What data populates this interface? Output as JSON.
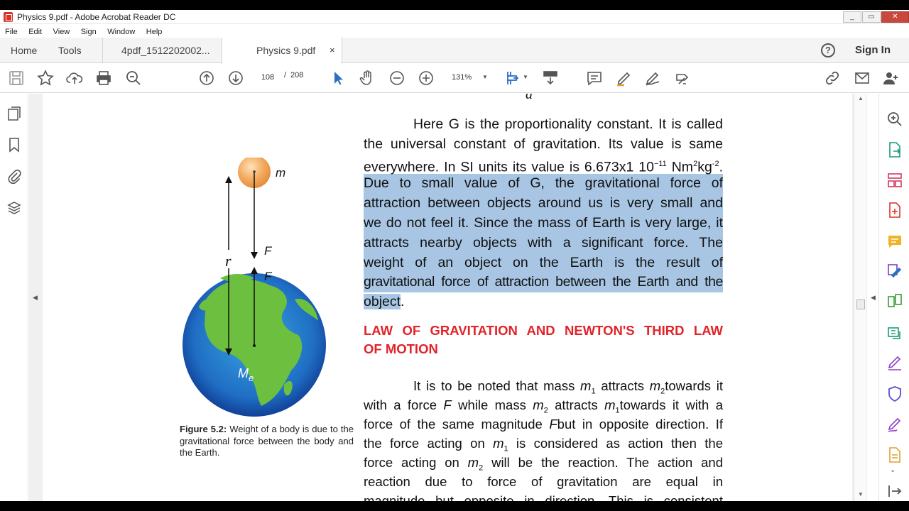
{
  "window": {
    "title": "Physics 9.pdf - Adobe Acrobat Reader DC",
    "controls": [
      "_",
      "▭",
      "✕"
    ]
  },
  "menu": [
    "File",
    "Edit",
    "View",
    "Sign",
    "Window",
    "Help"
  ],
  "tabs": {
    "home": "Home",
    "tools": "Tools",
    "doc1": "4pdf_1512202002...",
    "doc2": "Physics 9.pdf",
    "close": "×",
    "signin": "Sign In",
    "help": "?"
  },
  "toolbar": {
    "page_current": "108",
    "page_sep": "/",
    "page_total": "208",
    "zoom": "131%"
  },
  "document": {
    "top_fragment": "d",
    "para1_lines": [
      "Here G is the proportionality constant. It is called",
      "the universal constant of gravitation. Its value is same",
      "everywhere. In SI units its value is 6.673x1 10"
    ],
    "para1_unit_sup1": "−11",
    "para1_unit_mid": " Nm",
    "para1_unit_sup2": "2",
    "para1_unit_kg": "kg",
    "para1_unit_sup3": "-2",
    "para1_unit_end": ".",
    "highlighted_lines": [
      "Due to small value of G, the gravitational force of",
      "attraction between objects around us is very small and",
      "we do not feel it. Since the mass of Earth is very large, it",
      "attracts nearby objects with a significant force. The",
      "weight of an object on the Earth is the result of",
      "gravitational force of attraction between the Earth and the",
      "object"
    ],
    "highlight_end": ".",
    "section_heading_line1": "LAW OF GRAVITATION AND NEWTON'S THIRD LAW",
    "section_heading_line2": "OF MOTION",
    "para2": {
      "l1a": "It is to be noted that mass ",
      "m": "m",
      "s1": "1",
      "s2": "2",
      "l1b": " attracts ",
      "l1c": "towards it",
      "l2a": "with a force ",
      "F": "F",
      "l2b": " while mass ",
      "l2c": " attracts ",
      "l2d": "towards it with a",
      "l3a": "force of the same magnitude ",
      "l3b": "but in opposite direction. If",
      "l4a": "the force acting on ",
      "l4b": " is considered as action then the",
      "l5a": "force acting on ",
      "l5b": " will be the reaction. The action and",
      "l6": "reaction due to force of gravitation are equal in",
      "l7": "magnitude but opposite in direction. This is consistent"
    },
    "figure": {
      "label_m": "m",
      "label_r": "r",
      "label_F1": "F",
      "label_F2": "F",
      "label_Me_main": "M",
      "label_Me_sub": "e",
      "caption_bold": "Figure 5.2:",
      "caption_text": " Weight of a body is due to the gravitational force between the body and the Earth."
    }
  },
  "colors": {
    "highlight": "#a8c6e4",
    "heading_red": "#e2232a",
    "acrobat_red": "#d9342b"
  },
  "icons": {
    "toolbar": [
      "save-icon",
      "bookmark-star-icon",
      "upload-icon",
      "print-icon",
      "search-icon",
      "prev-page-icon",
      "next-page-icon",
      "select-cursor-icon",
      "hand-icon",
      "zoom-out-icon",
      "zoom-in-icon",
      "fit-page-icon",
      "scroll-mode-icon",
      "comment-icon",
      "highlighter-icon",
      "draw-icon",
      "sign-icon",
      "share-link-icon",
      "email-icon",
      "add-user-icon"
    ],
    "left_nav": [
      "page-thumbnails-icon",
      "bookmarks-icon",
      "attachments-icon",
      "layers-icon"
    ],
    "right_pane": [
      "zoom-tool-icon",
      "export-pdf-icon",
      "organize-pages-icon",
      "create-pdf-icon",
      "comment-tool-icon",
      "edit-pdf-icon",
      "combine-files-icon",
      "compare-icon",
      "fill-sign-icon",
      "protect-icon",
      "signature-icon",
      "more-tools-icon"
    ]
  }
}
